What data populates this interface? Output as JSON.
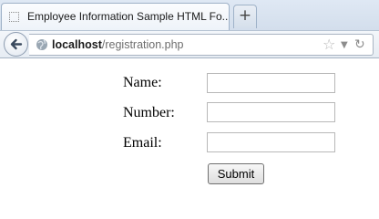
{
  "browser": {
    "tab_title": "Employee Information Sample HTML Fo...",
    "new_tab_symbol": "+",
    "url_host": "localhost",
    "url_path": "/registration.php",
    "icons": [
      "blank-page-icon",
      "back-arrow-icon",
      "globe-icon",
      "bookmark-star-icon",
      "dropdown-arrow-icon",
      "reload-icon"
    ]
  },
  "form": {
    "name_label": "Name:",
    "name_value": "",
    "number_label": "Number:",
    "number_value": "",
    "email_label": "Email:",
    "email_value": "",
    "submit_label": "Submit"
  }
}
